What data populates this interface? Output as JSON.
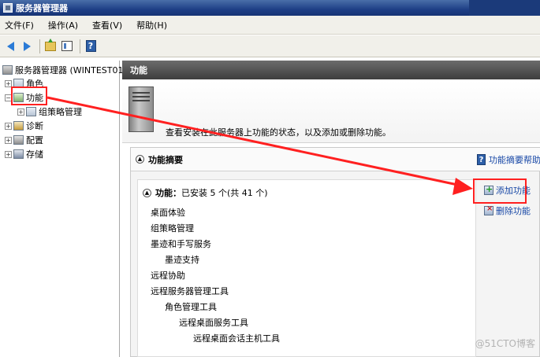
{
  "window": {
    "title": "服务器管理器"
  },
  "menu": [
    "文件(F)",
    "操作(A)",
    "查看(V)",
    "帮助(H)"
  ],
  "toolbar": {
    "help_label": "?"
  },
  "tree": {
    "root": "服务器管理器 (WINTEST01)",
    "items": [
      "角色",
      "功能",
      "组策略管理",
      "诊断",
      "配置",
      "存储"
    ]
  },
  "right": {
    "header": "功能",
    "intro": "查看安装在此服务器上功能的状态，以及添加或删除功能。",
    "summary_title": "功能摘要",
    "summary_help": "功能摘要帮助",
    "features_label": "功能：",
    "features_count": "已安装 5 个(共 41 个)",
    "features": [
      "桌面体验",
      "组策略管理",
      "墨迹和手写服务",
      "墨迹支持",
      "远程协助",
      "远程服务器管理工具",
      "角色管理工具",
      "远程桌面服务工具",
      "远程桌面会话主机工具"
    ],
    "actions": {
      "add": "添加功能",
      "remove": "删除功能"
    }
  },
  "colors": {
    "annotation": "#ff2020",
    "link": "#1747a6"
  },
  "watermark": "@51CTO博客"
}
